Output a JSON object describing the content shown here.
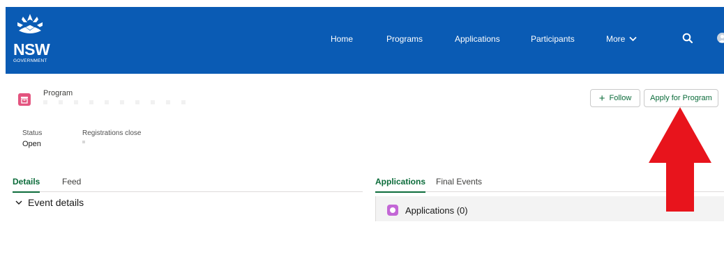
{
  "brand": {
    "word": "NSW",
    "sub": "GOVERNMENT"
  },
  "nav": {
    "items": [
      "Home",
      "Programs",
      "Applications",
      "Participants"
    ],
    "more_label": "More",
    "icons": [
      "search-icon",
      "user-avatar"
    ]
  },
  "record": {
    "type_label": "Program",
    "icon": "record-icon",
    "fields": [
      {
        "label": "Status",
        "value": "Open"
      },
      {
        "label": "Registrations close",
        "value": ""
      }
    ]
  },
  "actions": {
    "follow_label": "Follow",
    "apply_label": "Apply for Program"
  },
  "left_tabs": [
    "Details",
    "Feed"
  ],
  "left_tabs_active": "Details",
  "details_section": {
    "title": "Event details"
  },
  "right_tabs": [
    "Applications",
    "Final Events"
  ],
  "right_tabs_active": "Applications",
  "related_list": {
    "title": "Applications (0)"
  },
  "colors": {
    "header_blue": "#0a5bb4",
    "accent_green": "#0b6b3a",
    "record_icon_pink": "#e3547f",
    "related_icon_purple": "#c367d6",
    "annotation_red": "#e8141c"
  }
}
